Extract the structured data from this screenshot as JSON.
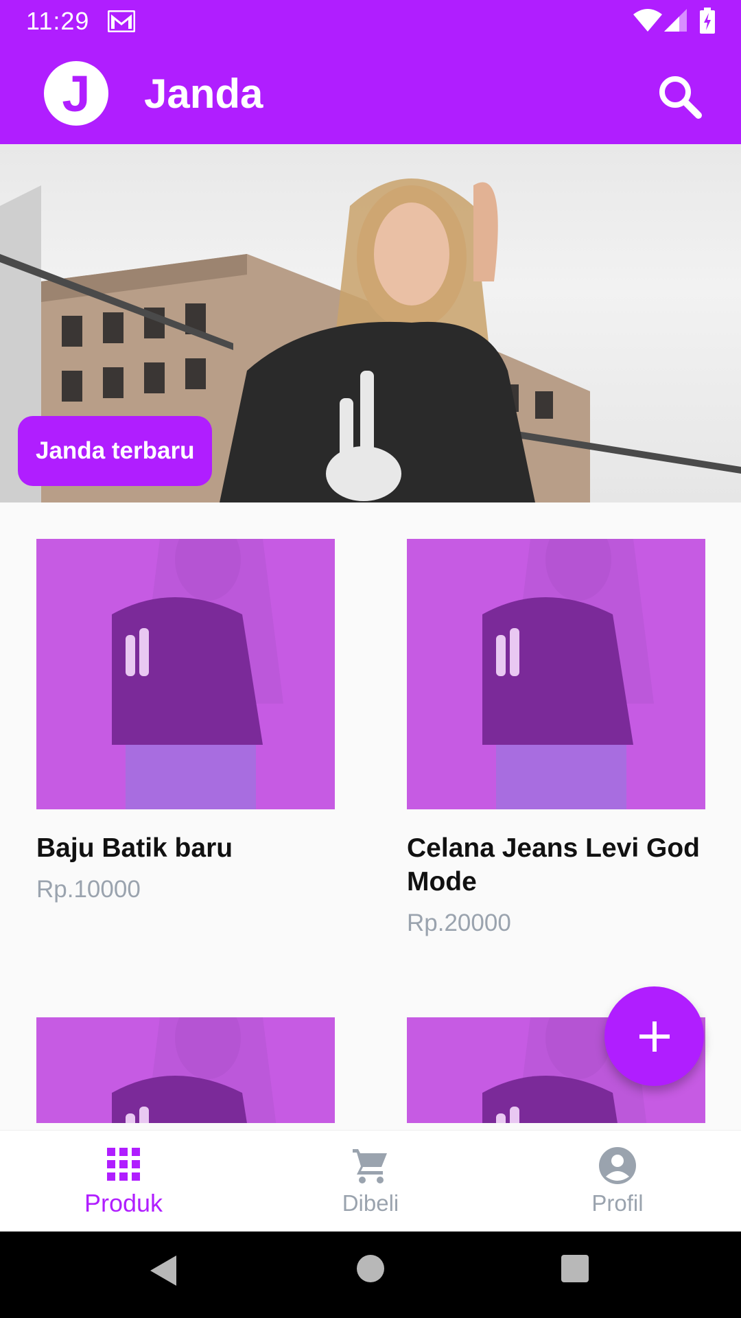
{
  "status_bar": {
    "time": "11:29",
    "icons": [
      "gmail-icon",
      "wifi-icon",
      "signal-icon",
      "battery-icon"
    ]
  },
  "app_bar": {
    "logo_letter": "J",
    "title": "Janda",
    "search_icon": "search-icon"
  },
  "hero": {
    "badge_label": "Janda terbaru"
  },
  "products": [
    {
      "title": "Baju Batik baru",
      "price": "Rp.10000"
    },
    {
      "title": "Celana Jeans Levi God Mode",
      "price": "Rp.20000"
    },
    {
      "title": "",
      "price": ""
    },
    {
      "title": "",
      "price": ""
    }
  ],
  "fab": {
    "icon": "plus-icon"
  },
  "bottom_nav": {
    "items": [
      {
        "label": "Produk",
        "icon": "grid-icon",
        "active": true
      },
      {
        "label": "Dibeli",
        "icon": "cart-icon",
        "active": false
      },
      {
        "label": "Profil",
        "icon": "account-circle-icon",
        "active": false
      }
    ]
  },
  "system_nav": [
    "back-icon",
    "home-icon",
    "recents-icon"
  ],
  "colors": {
    "primary": "#B01EFF",
    "price_text": "#9AA3AE",
    "inactive_nav": "#9AA3AE",
    "background": "#FAFAFA"
  }
}
